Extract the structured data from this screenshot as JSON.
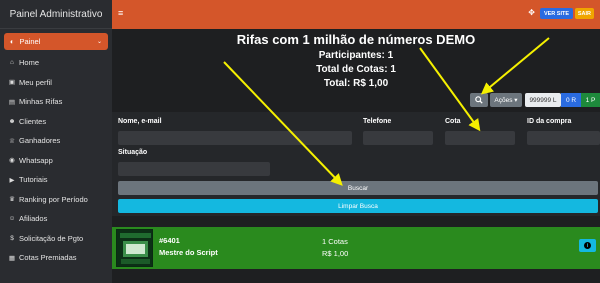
{
  "sidebar": {
    "brand": "Painel Administrativo",
    "active": {
      "label": "Painel",
      "icon": "palette-icon",
      "chevron": "chevron-down-icon"
    },
    "items": [
      {
        "label": "Home",
        "icon": "home-icon",
        "glyph": "⌂"
      },
      {
        "label": "Meu perfil",
        "icon": "id-card-icon",
        "glyph": "▣"
      },
      {
        "label": "Minhas Rifas",
        "icon": "ticket-icon",
        "glyph": "▤"
      },
      {
        "label": "Clientes",
        "icon": "users-icon",
        "glyph": "☻"
      },
      {
        "label": "Ganhadores",
        "icon": "trophy-icon",
        "glyph": "♕"
      },
      {
        "label": "Whatsapp",
        "icon": "whatsapp-icon",
        "glyph": "◉"
      },
      {
        "label": "Tutoriais",
        "icon": "video-icon",
        "glyph": "▶"
      },
      {
        "label": "Ranking por Período",
        "icon": "ranking-icon",
        "glyph": "♛"
      },
      {
        "label": "Afiliados",
        "icon": "user-plus-icon",
        "glyph": "☺"
      },
      {
        "label": "Solicitação de Pgto",
        "icon": "dollar-icon",
        "glyph": "$"
      },
      {
        "label": "Cotas Premiadas",
        "icon": "gift-icon",
        "glyph": "▦"
      }
    ]
  },
  "topbar": {
    "menu_icon": "≡",
    "expand_icon": "✥",
    "site_label": "VER SITE",
    "exit_label": "SAIR",
    "colors": {
      "bar": "#d4562a",
      "site": "#2a6be0",
      "exit": "#f0a500"
    }
  },
  "summary": {
    "title": "Rifas com 1 milhão de números DEMO",
    "participants": "Participantes: 1",
    "total_cotas": "Total de Cotas: 1",
    "total": "Total: R$ 1,00"
  },
  "controls": {
    "search_icon": "🔍",
    "actions_label": "Ações ▾",
    "count_label": "999999 L",
    "r_label": "0 R",
    "p_label": "1 P"
  },
  "filters": {
    "name_label": "Nome, e-mail",
    "phone_label": "Telefone",
    "cota_label": "Cota",
    "purchase_id_label": "ID da compra",
    "status_label": "Situação",
    "search_button": "Buscar",
    "clear_button": "Limpar Busca"
  },
  "rifa": {
    "id": "#6401",
    "name": "Mestre do Script",
    "cotas": "1 Cotas",
    "price": "R$ 1,00",
    "info_icon": "i"
  }
}
